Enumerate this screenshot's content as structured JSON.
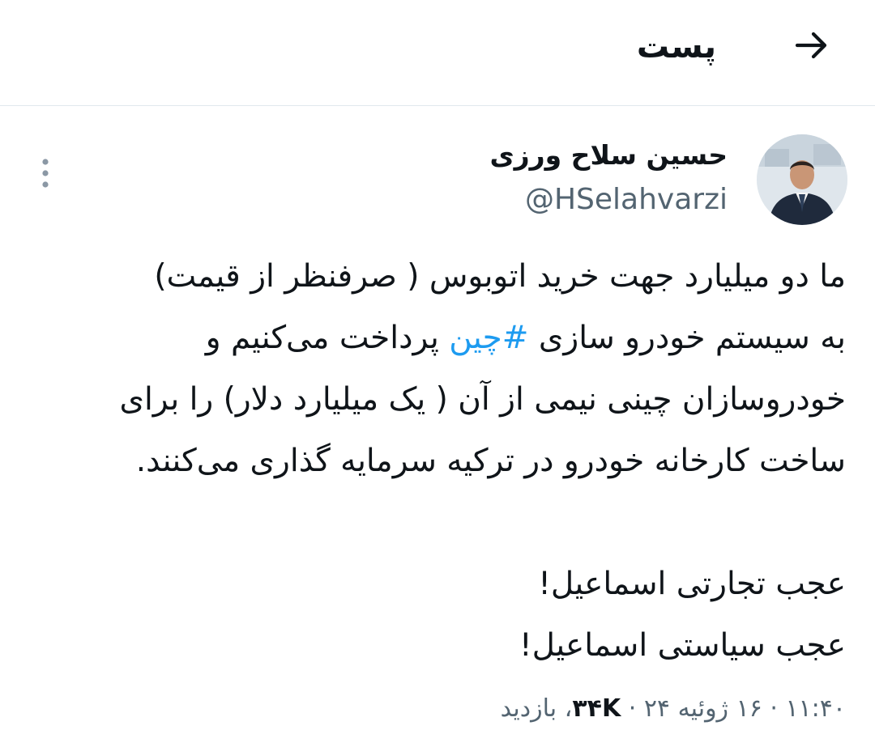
{
  "header": {
    "title": "پست",
    "back_icon": "arrow-right-icon"
  },
  "author": {
    "name": "حسین سلاح ورزی",
    "handle": "@HSelahvarzi",
    "avatar_icon": "avatar"
  },
  "more_icon": "vertical-dots-icon",
  "tweet": {
    "line1": "ما دو میلیارد جهت خرید اتوبوس ( صرفنظر از قیمت)",
    "line2_before": "به  سیستم  خودرو سازی ",
    "hashtag": "#چین",
    "line2_after": " پرداخت می‌کنیم و",
    "line3": "خودروسازان چینی نیمی از آن ( یک میلیارد دلار) را برای",
    "line4": "ساخت کارخانه خودرو در ترکیه سرمایه گذاری می‌کنند.",
    "line5": "عجب تجارتی اسماعیل!",
    "line6": "عجب سیاستی اسماعیل!"
  },
  "meta": {
    "timestamp": "۱۱:۴۰ · ۱۶ ژوئیه ۲۴ · ",
    "views_count": "۳۴K",
    "views_label": "، بازدید"
  },
  "colors": {
    "hashtag": "#1d9bf0",
    "secondary_text": "#536471",
    "primary_text": "#0f1419"
  }
}
